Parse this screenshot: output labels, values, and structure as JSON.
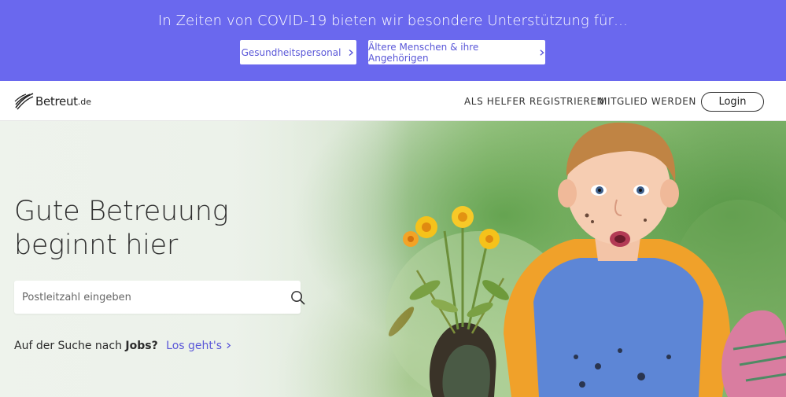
{
  "banner": {
    "title": "In Zeiten von COVID-19 bieten wir besondere Unterstützung für…",
    "buttons": [
      {
        "label": "Gesundheitspersonal",
        "icon": "chevron-right-icon"
      },
      {
        "label": "Ältere Menschen & ihre Angehörigen",
        "icon": "chevron-right-icon"
      }
    ],
    "background_color": "#6a68ee",
    "button_text_color": "#5a57d8"
  },
  "header": {
    "logo_text": "Betreut",
    "logo_tld": ".de",
    "nav": [
      {
        "label": "ALS HELFER REGISTRIEREN"
      },
      {
        "label": "MITGLIED WERDEN"
      }
    ],
    "login_label": "Login"
  },
  "hero": {
    "title_line1": "Gute Betreuung",
    "title_line2": "beginnt hier",
    "search": {
      "placeholder": "Postleitzahl eingeben",
      "value": "",
      "icon": "search-icon"
    },
    "jobs_prefix": "Auf der Suche nach",
    "jobs_word": "Jobs?",
    "jobs_link": "Los geht's",
    "accent_color": "#5a57d8"
  }
}
